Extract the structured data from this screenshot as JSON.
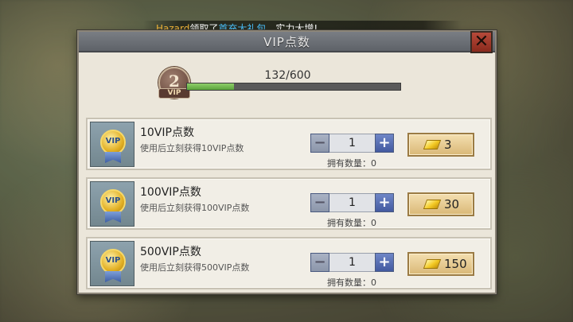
{
  "ticker": {
    "player": "Hazard",
    "action": "领取了",
    "item": "首充大礼包",
    "suffix": "，实力大增!"
  },
  "dialog": {
    "title": "VIP点数"
  },
  "vip": {
    "level": "2",
    "badge": "VIP",
    "progress_text": "132/600",
    "progress_fraction": 0.22
  },
  "items": [
    {
      "name": "10VIP点数",
      "desc": "使用后立刻获得10VIP点数",
      "qty": "1",
      "owned": "拥有数量：0",
      "price": "3",
      "minus": "−",
      "plus": "+"
    },
    {
      "name": "100VIP点数",
      "desc": "使用后立刻获得100VIP点数",
      "qty": "1",
      "owned": "拥有数量：0",
      "price": "30",
      "minus": "−",
      "plus": "+"
    },
    {
      "name": "500VIP点数",
      "desc": "使用后立刻获得500VIP点数",
      "qty": "1",
      "owned": "拥有数量：0",
      "price": "150",
      "minus": "−",
      "plus": "+"
    }
  ],
  "icons": {
    "close": "close-icon",
    "medal": "vip-medal-icon",
    "currency": "gold-ingot-icon"
  },
  "colors": {
    "progress_fill": "#6db84a",
    "ticker_name": "#f1b53a",
    "ticker_item": "#4cc3ff",
    "close_button": "#a33c2c"
  }
}
